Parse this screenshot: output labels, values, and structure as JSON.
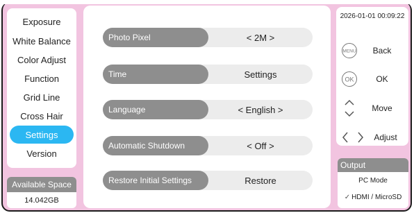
{
  "header": {
    "title": "Settings"
  },
  "menu": {
    "items": [
      {
        "label": "Exposure"
      },
      {
        "label": "White Balance"
      },
      {
        "label": "Color Adjust"
      },
      {
        "label": "Function"
      },
      {
        "label": "Grid Line"
      },
      {
        "label": "Cross Hair"
      },
      {
        "label": "Settings",
        "active": true
      },
      {
        "label": "Version"
      }
    ]
  },
  "storage": {
    "header": "Available Space",
    "value": "14.042GB"
  },
  "settings": {
    "rows": [
      {
        "label": "Photo Pixel",
        "value": "< 2M >"
      },
      {
        "label": "Time",
        "value": "Settings"
      },
      {
        "label": "Language",
        "value": "< English >"
      },
      {
        "label": "Automatic Shutdown",
        "value": "< Off >"
      },
      {
        "label": "Restore Initial Settings",
        "value": "Restore"
      }
    ]
  },
  "status": {
    "datetime": "2026-01-01 00:09:22"
  },
  "keys": {
    "menu_icon_text": "MENU",
    "ok_icon_text": "OK",
    "back": "Back",
    "ok": "OK",
    "move": "Move",
    "adjust": "Adjust"
  },
  "output": {
    "header": "Output",
    "options": [
      {
        "label": "PC Mode",
        "checked": false
      },
      {
        "label": "HDMI / MicroSD",
        "checked": true
      }
    ],
    "check_mark": "✓"
  },
  "colors": {
    "background": "#f2c4e0",
    "accent": "#2bb7f2",
    "label_gray": "#8e8e8e"
  }
}
